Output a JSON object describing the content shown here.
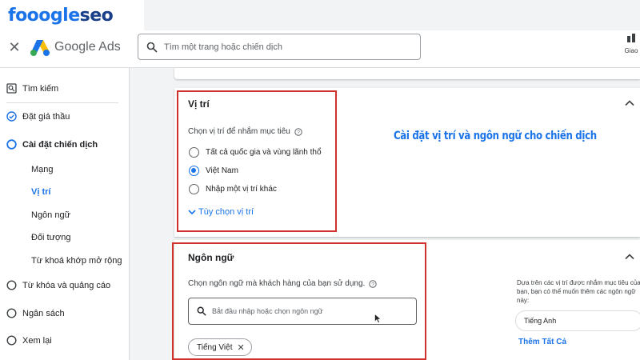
{
  "brand": {
    "part_a": "fooogle",
    "part_b": "seo"
  },
  "topbar": {
    "app_title": "Google Ads",
    "search_placeholder": "Tìm một trang hoặc chiến dịch",
    "tool_label": "Giao"
  },
  "sidebar": {
    "items": [
      {
        "label": "Tìm kiếm",
        "icon": "search-box-icon"
      },
      {
        "label": "Đặt giá thầu",
        "icon": "check-circle-icon"
      },
      {
        "label": "Cài đặt chiến dịch",
        "icon": "radio-circle-icon"
      },
      {
        "label": "Từ khóa và quảng cáo",
        "icon": "radio-circle-icon"
      },
      {
        "label": "Ngân sách",
        "icon": "radio-circle-icon"
      },
      {
        "label": "Xem lại",
        "icon": "radio-circle-icon"
      }
    ],
    "sub_items": [
      "Mạng",
      "Vị trí",
      "Ngôn ngữ",
      "Đối tượng",
      "Từ khoá khớp mở rộng"
    ],
    "active_sub": "Vị trí"
  },
  "location": {
    "title": "Vị trí",
    "hint": "Chọn vị trí để nhắm mục tiêu",
    "options": [
      "Tất cả quốc gia và vùng lãnh thổ",
      "Việt Nam",
      "Nhập một vị trí khác"
    ],
    "selected": "Việt Nam",
    "more_options": "Tùy chọn vị trí"
  },
  "language": {
    "title": "Ngôn ngữ",
    "hint": "Chọn ngôn ngữ mà khách hàng của bạn sử dụng.",
    "search_placeholder": "Bắt đầu nhập hoặc chọn ngôn ngữ",
    "selected_chip": "Tiếng Việt",
    "suggest_text": "Dựa trên các vị trí được nhắm mục tiêu của bạn, bạn có thể muốn thêm các ngôn ngữ này:",
    "suggested_language": "Tiếng Anh",
    "add_all": "Thêm Tất Cả"
  },
  "annotation": {
    "caption": "Cài đặt vị trí và ngôn ngữ cho chiến dịch"
  },
  "colors": {
    "accent": "#1a73e8",
    "annotation_red": "#d0312d",
    "brand_dark": "#1a3f8a"
  }
}
